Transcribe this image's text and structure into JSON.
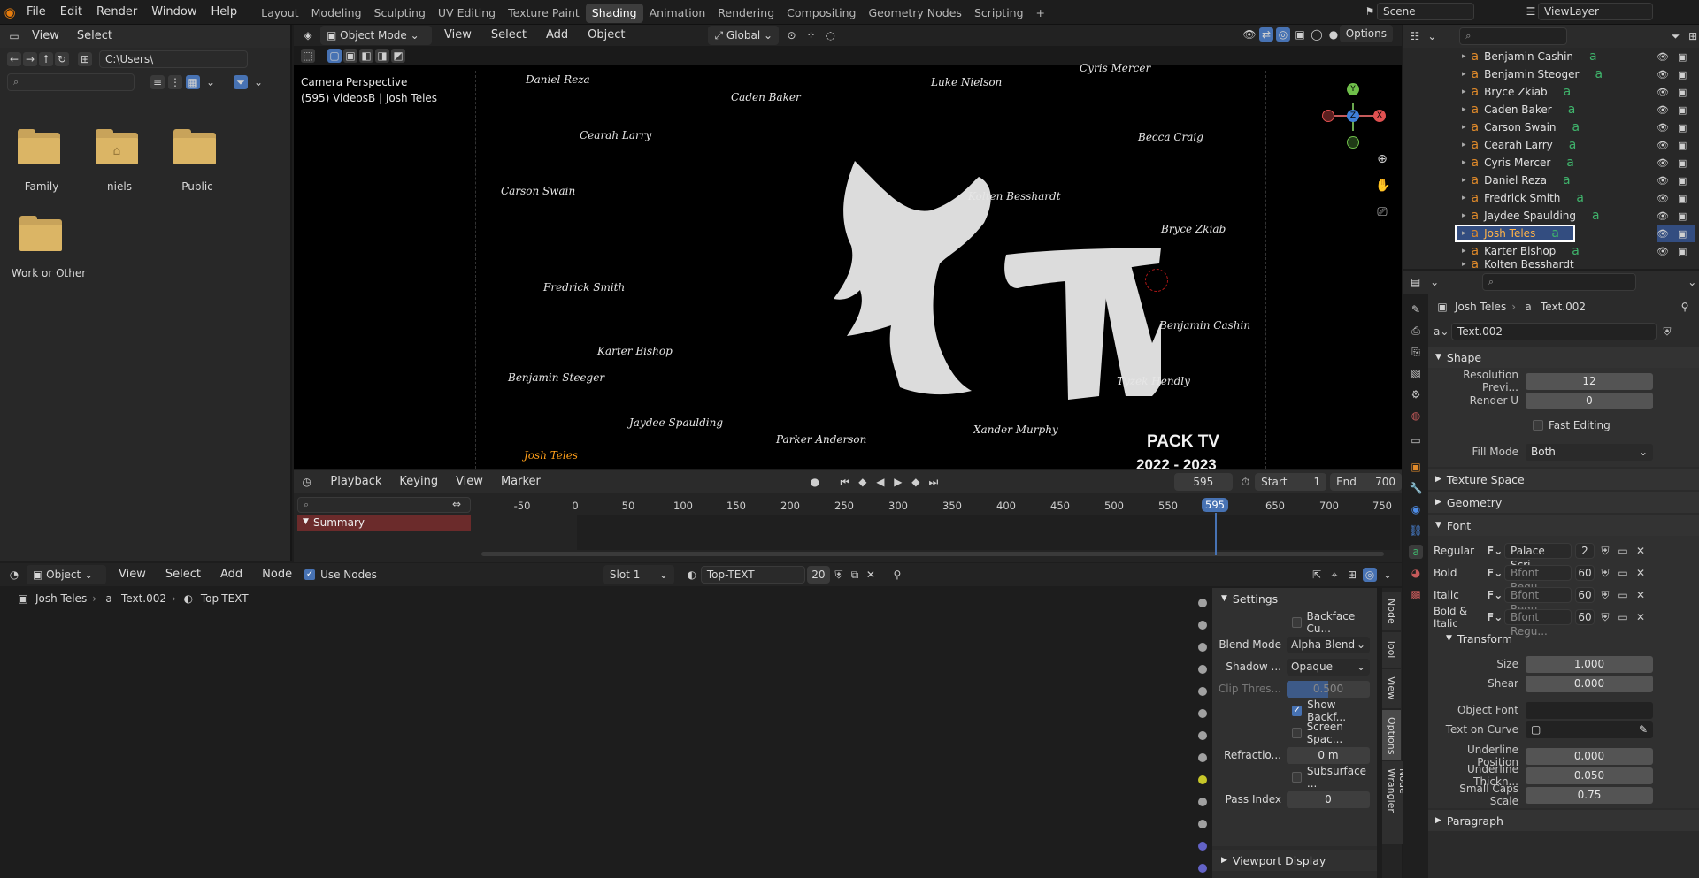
{
  "topbar": {
    "menus": [
      "File",
      "Edit",
      "Render",
      "Window",
      "Help"
    ],
    "workspaces": [
      "Layout",
      "Modeling",
      "Sculpting",
      "UV Editing",
      "Texture Paint",
      "Shading",
      "Animation",
      "Rendering",
      "Compositing",
      "Geometry Nodes",
      "Scripting"
    ],
    "active_workspace": "Shading",
    "add_tab": "+",
    "scene": "Scene",
    "view_layer": "ViewLayer"
  },
  "file_browser": {
    "menus": [
      "View",
      "Select"
    ],
    "path": "C:\\Users\\",
    "items": [
      {
        "label": "Family",
        "icon": "folder-icon"
      },
      {
        "label": "niels",
        "icon": "home-folder-icon"
      },
      {
        "label": "Public",
        "icon": "folder-icon"
      },
      {
        "label": "Work or Other",
        "icon": "folder-icon"
      }
    ]
  },
  "viewport": {
    "mode": "Object Mode",
    "menus": [
      "View",
      "Select",
      "Add",
      "Object"
    ],
    "orientation": "Global",
    "options": "Options",
    "camera_label": "Camera Perspective",
    "camera_sub": "(595) VideosB | Josh Teles",
    "logo_text": "TV",
    "names": [
      "Daniel Reza",
      "Caden Baker",
      "Luke Nielson",
      "Cyris Mercer",
      "Cearah Larry",
      "Becca Craig",
      "Carson Swain",
      "Kolten Besshardt",
      "Bryce Zkiab",
      "Fredrick Smith",
      "Benjamin Cashin",
      "Karter Bishop",
      "Benjamin Steeger",
      "Tyzek Hendly",
      "Jaydee Spaulding",
      "Parker Anderson",
      "Xander Murphy",
      "Josh Teles"
    ],
    "pack_title": "PACK TV",
    "pack_years": "2022 - 2023",
    "gizmo_axes": [
      "Y",
      "Z",
      "X"
    ]
  },
  "timeline": {
    "menus": [
      "Playback",
      "Keying",
      "View",
      "Marker"
    ],
    "current_frame": "595",
    "start_label": "Start",
    "start": "1",
    "end_label": "End",
    "end": "700",
    "ticks": [
      "-50",
      "0",
      "50",
      "100",
      "150",
      "200",
      "250",
      "300",
      "350",
      "400",
      "450",
      "500",
      "550",
      "595",
      "650",
      "700",
      "750"
    ],
    "summary": "Summary"
  },
  "node_editor": {
    "type": "Object",
    "menus": [
      "View",
      "Select",
      "Add",
      "Node"
    ],
    "use_nodes": "Use Nodes",
    "slot": "Slot 1",
    "material": "Top-TEXT",
    "users": "20",
    "breadcrumb": [
      "Josh Teles",
      "Text.002",
      "Top-TEXT"
    ],
    "side_tabs": [
      "Node",
      "Tool",
      "View",
      "Options",
      "Node Wrangler"
    ],
    "settings_title": "Settings",
    "backface": "Backface Cu...",
    "blend_label": "Blend Mode",
    "blend_value": "Alpha Blend",
    "shadow_label": "Shadow ...",
    "shadow_value": "Opaque",
    "clip_label": "Clip Thres...",
    "clip_value": "0.500",
    "show_backface": "Show Backf...",
    "screen_space": "Screen Spac...",
    "refraction_label": "Refractio...",
    "refraction_value": "0 m",
    "subsurface": "Subsurface ...",
    "pass_label": "Pass Index",
    "pass_value": "0",
    "viewport_display": "Viewport Display"
  },
  "outliner": {
    "items": [
      "Benjamin Cashin",
      "Benjamin Steoger",
      "Bryce Zkiab",
      "Caden Baker",
      "Carson Swain",
      "Cearah Larry",
      "Cyris Mercer",
      "Daniel Reza",
      "Fredrick Smith",
      "Jaydee Spaulding",
      "Josh Teles",
      "Karter Bishop",
      "Kolten Besshardt"
    ],
    "selected": "Josh Teles"
  },
  "properties": {
    "breadcrumb_object": "Josh Teles",
    "breadcrumb_data": "Text.002",
    "datablock": "Text.002",
    "shape_title": "Shape",
    "resolution_label": "Resolution Previ...",
    "resolution_value": "12",
    "render_u_label": "Render U",
    "render_u_value": "0",
    "fast_editing": "Fast Editing",
    "fill_mode_label": "Fill Mode",
    "fill_mode_value": "Both",
    "texture_space": "Texture Space",
    "geometry": "Geometry",
    "font_title": "Font",
    "fonts": [
      {
        "label": "Regular",
        "name": "Palace Scri...",
        "users": "2"
      },
      {
        "label": "Bold",
        "name": "Bfont Regu...",
        "users": "60"
      },
      {
        "label": "Italic",
        "name": "Bfont Regu...",
        "users": "60"
      },
      {
        "label": "Bold & Italic",
        "name": "Bfont Regu...",
        "users": "60"
      }
    ],
    "transform_title": "Transform",
    "size_label": "Size",
    "size_value": "1.000",
    "shear_label": "Shear",
    "shear_value": "0.000",
    "object_font_label": "Object Font",
    "text_on_curve_label": "Text on Curve",
    "underline_pos_label": "Underline Position",
    "underline_pos_value": "0.000",
    "underline_thick_label": "Underline Thickn...",
    "underline_thick_value": "0.050",
    "small_caps_label": "Small Caps Scale",
    "small_caps_value": "0.75",
    "paragraph": "Paragraph"
  },
  "colors": {
    "accent_blue": "#4772b3",
    "selection": "#334d80",
    "folder": "#d4ad60",
    "text_orange": "#ff9f1a"
  }
}
